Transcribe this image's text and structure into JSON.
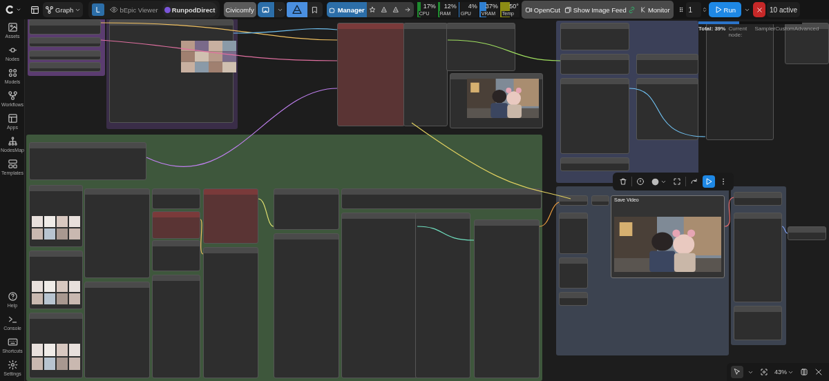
{
  "sidebar": {
    "items": [
      {
        "label": "Assets"
      },
      {
        "label": "Nodes"
      },
      {
        "label": "Models"
      },
      {
        "label": "Workflows"
      },
      {
        "label": "Apps"
      },
      {
        "label": "NodesMap"
      },
      {
        "label": "Templates"
      }
    ],
    "bottom_items": [
      {
        "label": "Help"
      },
      {
        "label": "Console"
      },
      {
        "label": "Shortcuts"
      },
      {
        "label": "Settings"
      }
    ]
  },
  "topbar": {
    "graph_tab": "Graph",
    "viewer": "bEpic Viewer",
    "runpod": "RunpodDirect",
    "civicomfy": "Civicomfy",
    "manager": "Manager",
    "monitors": [
      {
        "label": "CPU",
        "value": "17%",
        "level": 0.17,
        "color": "#1f8a2e"
      },
      {
        "label": "RAM",
        "value": "12%",
        "level": 0.12,
        "color": "#1f8a2e"
      },
      {
        "label": "GPU",
        "value": "4%",
        "level": 0.04,
        "color": "#2f7fd0"
      },
      {
        "label": "VRAM",
        "value": "37%",
        "level": 0.37,
        "color": "#2f7fd0"
      },
      {
        "label": "Temp",
        "value": "50°",
        "level": 0.5,
        "color": "#8c8c14"
      }
    ],
    "tools": [
      "OpenCut",
      "Show Image Feed",
      "Monitor"
    ],
    "queue_count": "1",
    "run": "Run",
    "active": "10 active"
  },
  "progress": {
    "level": 0.39,
    "total": "Total: 39%",
    "current_label": "Current node:",
    "current_node": "SamplerCustomAdvanced"
  },
  "canvas": {
    "nodes": [
      {
        "title": "Save Video"
      }
    ]
  },
  "canvas_controls": {
    "zoom": "43%"
  }
}
